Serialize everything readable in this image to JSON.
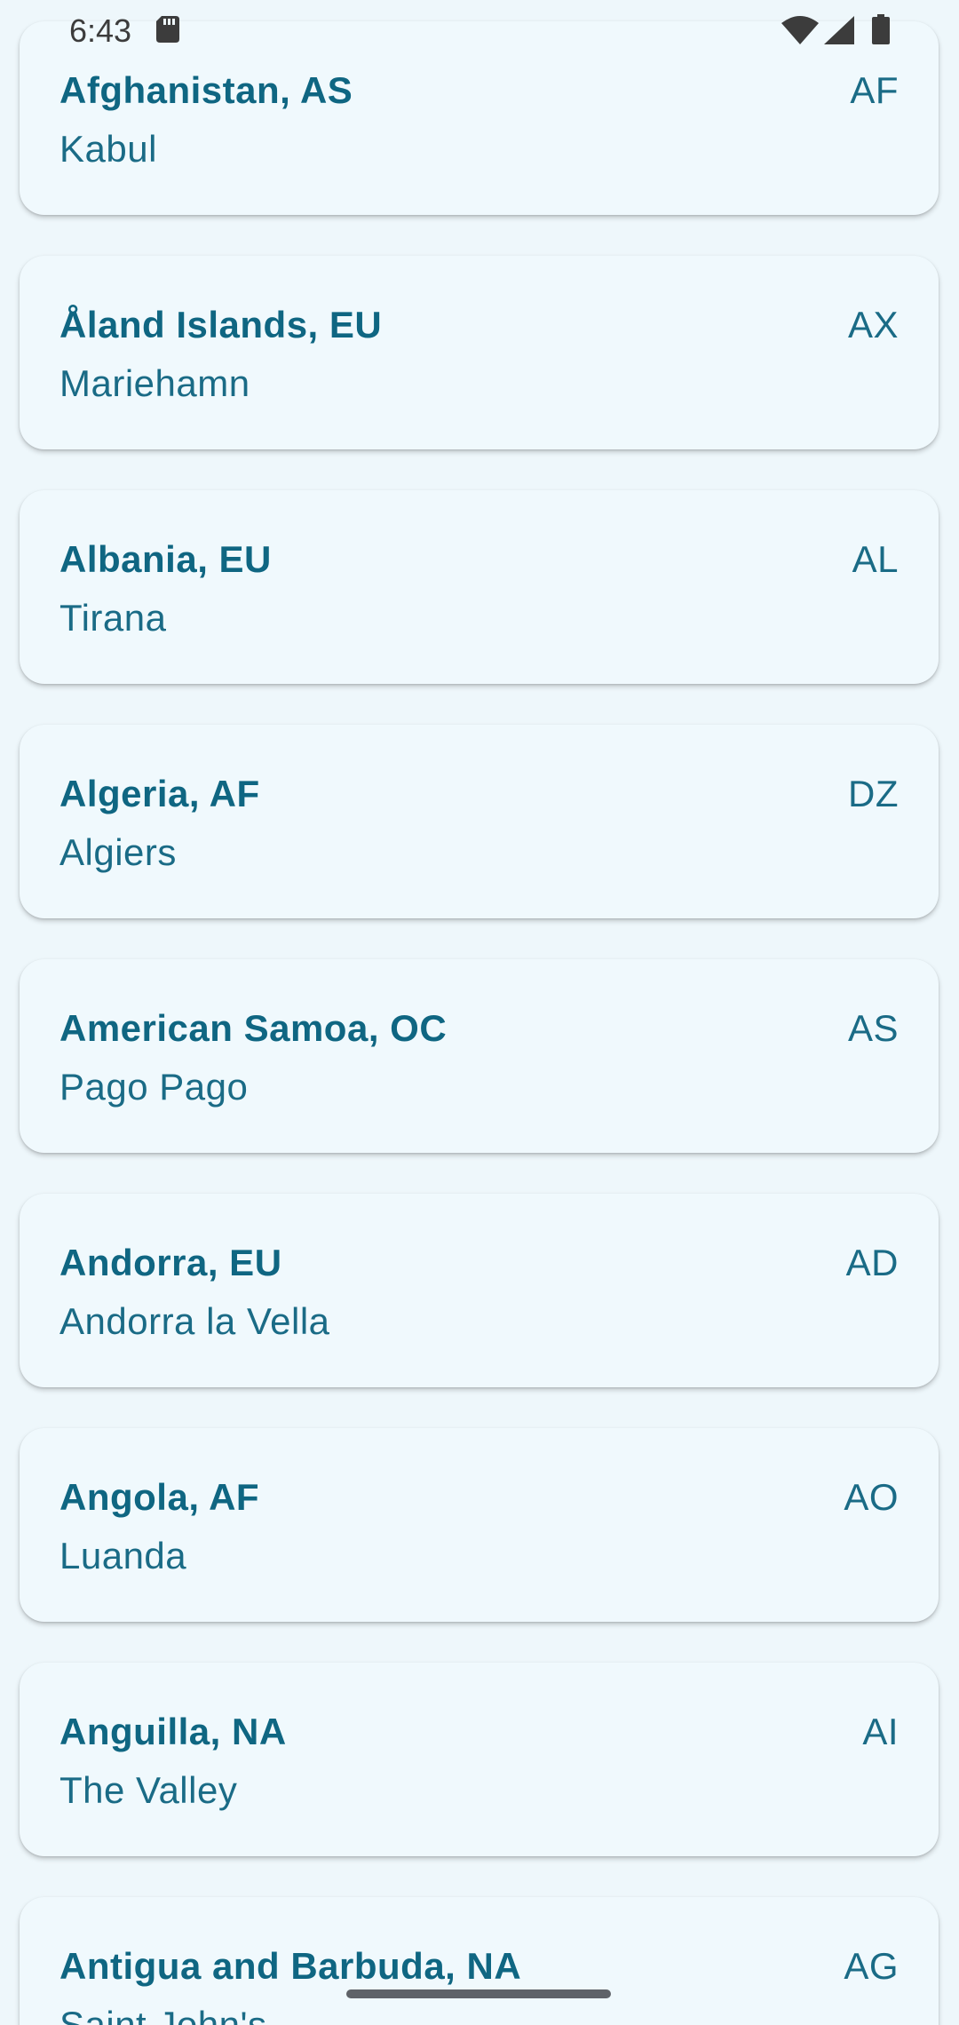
{
  "status_bar": {
    "time": "6:43",
    "icons": [
      "sd-card-icon",
      "wifi-icon",
      "cellular-signal-icon",
      "battery-icon"
    ]
  },
  "colors": {
    "background": "#eef7fb",
    "card": "#f0f9fd",
    "primary_text": "#0f6682"
  },
  "countries": [
    {
      "name": "Afghanistan, AS",
      "capital": "Kabul",
      "code": "AF"
    },
    {
      "name": "Åland Islands, EU",
      "capital": "Mariehamn",
      "code": "AX"
    },
    {
      "name": "Albania, EU",
      "capital": "Tirana",
      "code": "AL"
    },
    {
      "name": "Algeria, AF",
      "capital": "Algiers",
      "code": "DZ"
    },
    {
      "name": "American Samoa, OC",
      "capital": "Pago Pago",
      "code": "AS"
    },
    {
      "name": "Andorra, EU",
      "capital": "Andorra la Vella",
      "code": "AD"
    },
    {
      "name": "Angola, AF",
      "capital": "Luanda",
      "code": "AO"
    },
    {
      "name": "Anguilla, NA",
      "capital": "The Valley",
      "code": "AI"
    },
    {
      "name": "Antigua and Barbuda, NA",
      "capital": "Saint John's",
      "code": "AG"
    }
  ]
}
